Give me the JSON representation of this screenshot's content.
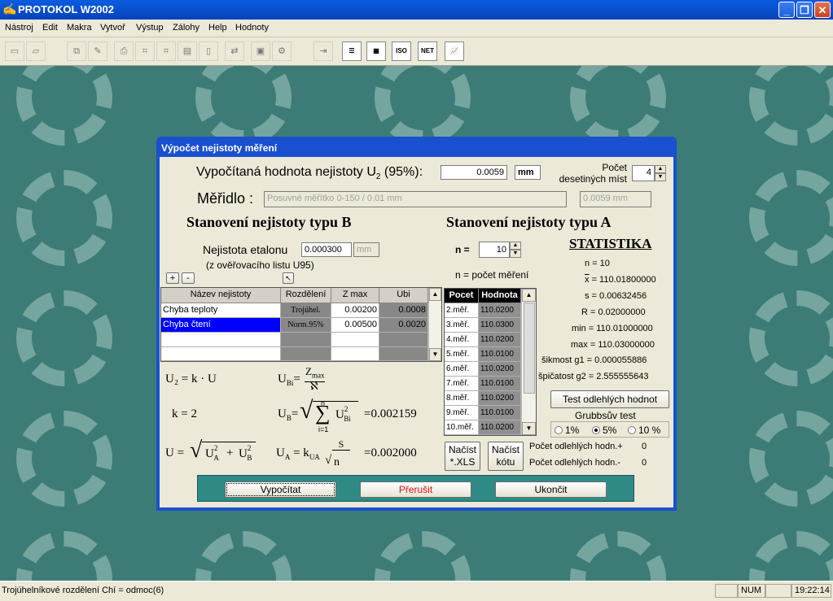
{
  "window": {
    "title": "PROTOKOL W2002"
  },
  "menu": [
    "Nástroj",
    "Edit",
    "Makra",
    "Vytvoř",
    "Výstup",
    "Zálohy",
    "Help",
    "Hodnoty"
  ],
  "toolbar": {
    "iso_label": "ISO",
    "net_label": "NET"
  },
  "dialog": {
    "title": "Výpočet nejistoty měření",
    "result_label": "Vypočítaná hodnota nejistoty U",
    "result_sub": "2",
    "result_pct": "(95%):",
    "result_value": "0.0059",
    "result_unit": "mm",
    "decimals_label_1": "Počet",
    "decimals_label_2": "desetiných míst",
    "decimals_value": "4",
    "meridlo_label": "Měřidlo :",
    "meridlo_value": "Posuvné měřítko 0-150 / 0.01 mm",
    "meridlo_uncert": "0.0059 mm",
    "typeB": {
      "heading": "Stanovení nejistoty typu  B",
      "etalon_label": "Nejistota etalonu",
      "etalon_value": "0.000300",
      "etalon_unit": "mm",
      "etalon_source": "(z ověřovacího listu U95)",
      "plus": "+",
      "minus": "-",
      "columns": [
        "Název nejistoty",
        "Rozdělení",
        "Z max",
        "Ubi"
      ],
      "rows": [
        {
          "name": "Chyba teploty",
          "dist": "Trojúhel.",
          "zmax": "0.00200",
          "ubi": "0.0008"
        },
        {
          "name": "Chyba čtení",
          "dist": "Norm.95%",
          "zmax": "0.00500",
          "ubi": "0.0020"
        }
      ]
    },
    "formulas": {
      "u2": "U₂ = k · U",
      "ubi_lhs": "U",
      "ubi_sub": "Bi",
      "ubi_num": "Z",
      "ubi_num_sub": "max",
      "ubi_den": "ℵ",
      "k": "k = 2",
      "ub_lhs": "U",
      "ub_sub": "B",
      "sum_top": "n",
      "sum_bottom": "i=1",
      "ub_term": "U",
      "ub_term_sub": "Bi",
      "ub_term_sup": "2",
      "ub_value": "=0.002159",
      "u_lhs": "U =",
      "u_a": "U",
      "u_a_sub": "A",
      "u_b": "U",
      "u_b_sub": "B",
      "u_sup": "2",
      "plus": "+",
      "ua_lhs": "U",
      "ua_sub": "A",
      "ua_k": "= k",
      "ua_k_sub": "UA",
      "ua_num": "S",
      "ua_den": "n",
      "ua_value": "=0.002000"
    },
    "typeA": {
      "heading": "Stanovení nejistoty typu  A",
      "n_label": "n =",
      "n_value": "10",
      "n_desc": "n = počet měření",
      "columns": [
        "Pocet",
        "Hodnota"
      ],
      "rows": [
        {
          "idx": "2.měř.",
          "val": "110.0200"
        },
        {
          "idx": "3.měř.",
          "val": "110.0300"
        },
        {
          "idx": "4.měř.",
          "val": "110.0200"
        },
        {
          "idx": "5.měř.",
          "val": "110.0100"
        },
        {
          "idx": "6.měř.",
          "val": "110.0200"
        },
        {
          "idx": "7.měř.",
          "val": "110.0100"
        },
        {
          "idx": "8.měř.",
          "val": "110.0200"
        },
        {
          "idx": "9.měř.",
          "val": "110.0100"
        },
        {
          "idx": "10.měř.",
          "val": "110.0200"
        }
      ],
      "load_xls_1": "Načíst",
      "load_xls_2": "*.XLS",
      "load_kota_1": "Načíst",
      "load_kota_2": "kótu"
    },
    "stats": {
      "heading": "STATISTIKA",
      "n": "n = 10",
      "xbar_sym": "x",
      "xbar": "= 110.01800000",
      "s": "s = 0.00632456",
      "r": "R = 0.02000000",
      "min": "min = 110.01000000",
      "max": "max = 110.03000000",
      "skew": "šikmost g1 = 0.000055886",
      "kurt": "špičatost g2 = 2.555555643",
      "outlier_btn": "Test odlehlých hodnot",
      "grubbs_label": "Grubbsův test",
      "opt1": "1%",
      "opt5": "5%",
      "opt10": "10 %",
      "selected_option": "5%",
      "out_plus_label": "Počet odlehlých hodn.+",
      "out_plus": "0",
      "out_minus_label": "Počet odlehlých hodn.-",
      "out_minus": "0"
    },
    "buttons": {
      "compute": "Vypočítat",
      "interrupt": "Přerušit",
      "close": "Ukončit"
    }
  },
  "status": {
    "text": "Trojúhelníkové rozdělení   Chí = odmoc(6)",
    "num": "NUM",
    "time": "19:22:14"
  },
  "colors": {
    "titlebar": "#0a5ce0",
    "desktop": "#3d7c76",
    "selection": "#0000ff",
    "button_bar": "#2f8a86",
    "interrupt_text": "#e01010"
  }
}
